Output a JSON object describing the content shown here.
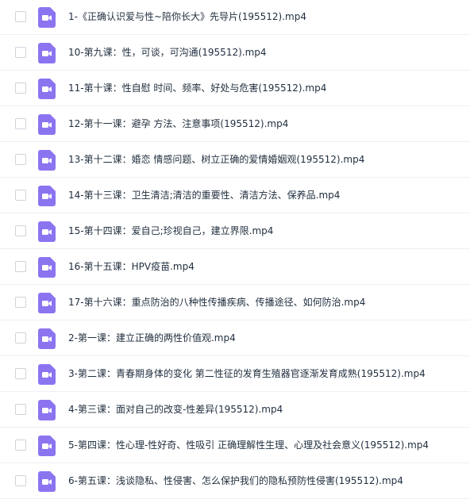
{
  "colors": {
    "icon_bg": "#8c74f0",
    "icon_glyph": "#ffffff",
    "text": "#1f2d3d",
    "divider": "#eef0f3",
    "checkbox_border": "#cfd3d9"
  },
  "files": [
    {
      "name": "1-《正确认识爱与性~陪你长大》先导片(195512).mp4",
      "icon": "video-file-icon"
    },
    {
      "name": "10-第九课：性，可谈，可沟通(195512).mp4",
      "icon": "video-file-icon"
    },
    {
      "name": "11-第十课：性自慰 时间、频率、好处与危害(195512).mp4",
      "icon": "video-file-icon"
    },
    {
      "name": "12-第十一课：避孕 方法、注意事项(195512).mp4",
      "icon": "video-file-icon"
    },
    {
      "name": "13-第十二课：婚恋 情感问题、树立正确的爱情婚姻观(195512).mp4",
      "icon": "video-file-icon"
    },
    {
      "name": "14-第十三课：卫生清洁;清洁的重要性、清洁方法、保养品.mp4",
      "icon": "video-file-icon"
    },
    {
      "name": "15-第十四课：爱自己;珍视自己，建立界限.mp4",
      "icon": "video-file-icon"
    },
    {
      "name": "16-第十五课：HPV疫苗.mp4",
      "icon": "video-file-icon"
    },
    {
      "name": "17-第十六课：重点防治的八种性传播疾病、传播途径、如何防治.mp4",
      "icon": "video-file-icon"
    },
    {
      "name": "2-第一课：建立正确的两性价值观.mp4",
      "icon": "video-file-icon"
    },
    {
      "name": "3-第二课：青春期身体的变化 第二性征的发育生殖器官逐渐发育成熟(195512).mp4",
      "icon": "video-file-icon"
    },
    {
      "name": "4-第三课：面对自己的改变-性差异(195512).mp4",
      "icon": "video-file-icon"
    },
    {
      "name": "5-第四课：性心理-性好奇、性吸引 正确理解性生理、心理及社会意义(195512).mp4",
      "icon": "video-file-icon"
    },
    {
      "name": "6-第五课：浅谈隐私、性侵害、怎么保护我们的隐私预防性侵害(195512).mp4",
      "icon": "video-file-icon"
    }
  ]
}
